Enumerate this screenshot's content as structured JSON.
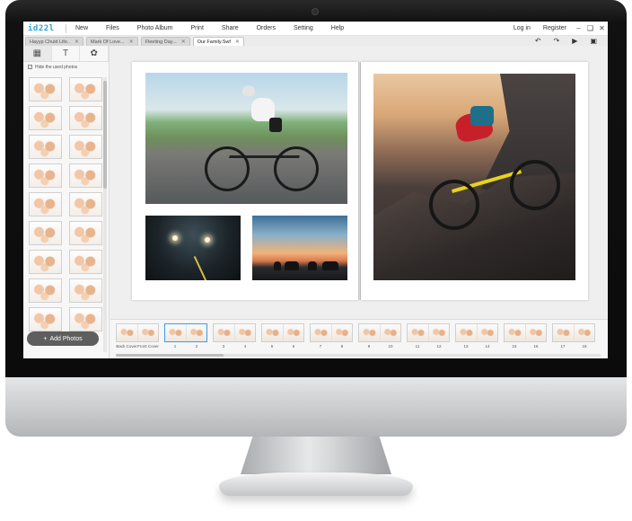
{
  "app": {
    "logo": "id22l",
    "menu": [
      "New",
      "Files",
      "Photo Album",
      "Print",
      "Share",
      "Orders",
      "Setting",
      "Help"
    ],
    "auth": {
      "login": "Log in",
      "register": "Register"
    }
  },
  "tabs": [
    {
      "label": "Hayyp Chuld Life..",
      "active": false
    },
    {
      "label": "Mark Of Love...",
      "active": false
    },
    {
      "label": "Fleeting Day...",
      "active": false
    },
    {
      "label": "Our Family.Swf",
      "active": true
    }
  ],
  "toolbar": {
    "icons": [
      "undo-icon",
      "redo-icon",
      "play-icon",
      "save-icon"
    ]
  },
  "sidebar": {
    "hide_used_label": "Hide the used photos",
    "add_photos_label": "Add Photos",
    "tabs": [
      "image-icon",
      "text-icon",
      "decoration-icon"
    ]
  },
  "strip": {
    "labels": [
      "Back Cover",
      "Front Cover",
      "1",
      "2",
      "3",
      "4",
      "5",
      "6",
      "7",
      "8",
      "9",
      "10",
      "11",
      "12",
      "13",
      "14",
      "15",
      "16",
      "17",
      "18"
    ]
  },
  "colors": {
    "accent": "#2f9fd8",
    "selected_border": "#3a9ee4"
  }
}
